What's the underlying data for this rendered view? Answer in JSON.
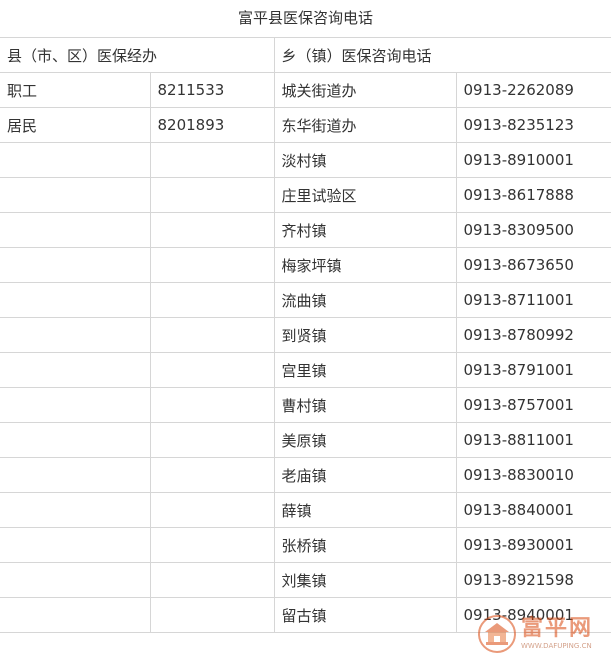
{
  "title": "富平县医保咨询电话",
  "header": {
    "county_heading": "县（市、区）医保经办",
    "township_heading": "乡（镇）医保咨询电话"
  },
  "county_rows": [
    {
      "name": "职工",
      "phone": "8211533"
    },
    {
      "name": "居民",
      "phone": "8201893"
    }
  ],
  "township_rows": [
    {
      "name": "城关街道办",
      "phone": "0913-2262089"
    },
    {
      "name": "东华街道办",
      "phone": "0913-8235123"
    },
    {
      "name": "淡村镇",
      "phone": "0913-8910001"
    },
    {
      "name": "庄里试验区",
      "phone": "0913-8617888"
    },
    {
      "name": "齐村镇",
      "phone": "0913-8309500"
    },
    {
      "name": "梅家坪镇",
      "phone": "0913-8673650"
    },
    {
      "name": "流曲镇",
      "phone": "0913-8711001"
    },
    {
      "name": "到贤镇",
      "phone": "0913-8780992"
    },
    {
      "name": "宫里镇",
      "phone": "0913-8791001"
    },
    {
      "name": "曹村镇",
      "phone": "0913-8757001"
    },
    {
      "name": "美原镇",
      "phone": "0913-8811001"
    },
    {
      "name": "老庙镇",
      "phone": "0913-8830010"
    },
    {
      "name": "薛镇",
      "phone": "0913-8840001"
    },
    {
      "name": "张桥镇",
      "phone": "0913-8930001"
    },
    {
      "name": "刘集镇",
      "phone": "0913-8921598"
    },
    {
      "name": "留古镇",
      "phone": "0913-8940001"
    }
  ],
  "watermark": {
    "text": "富平网",
    "subtext": "WWW.DAFUPING.CN",
    "icon": "gate-tower-icon",
    "color": "#d9480f"
  }
}
